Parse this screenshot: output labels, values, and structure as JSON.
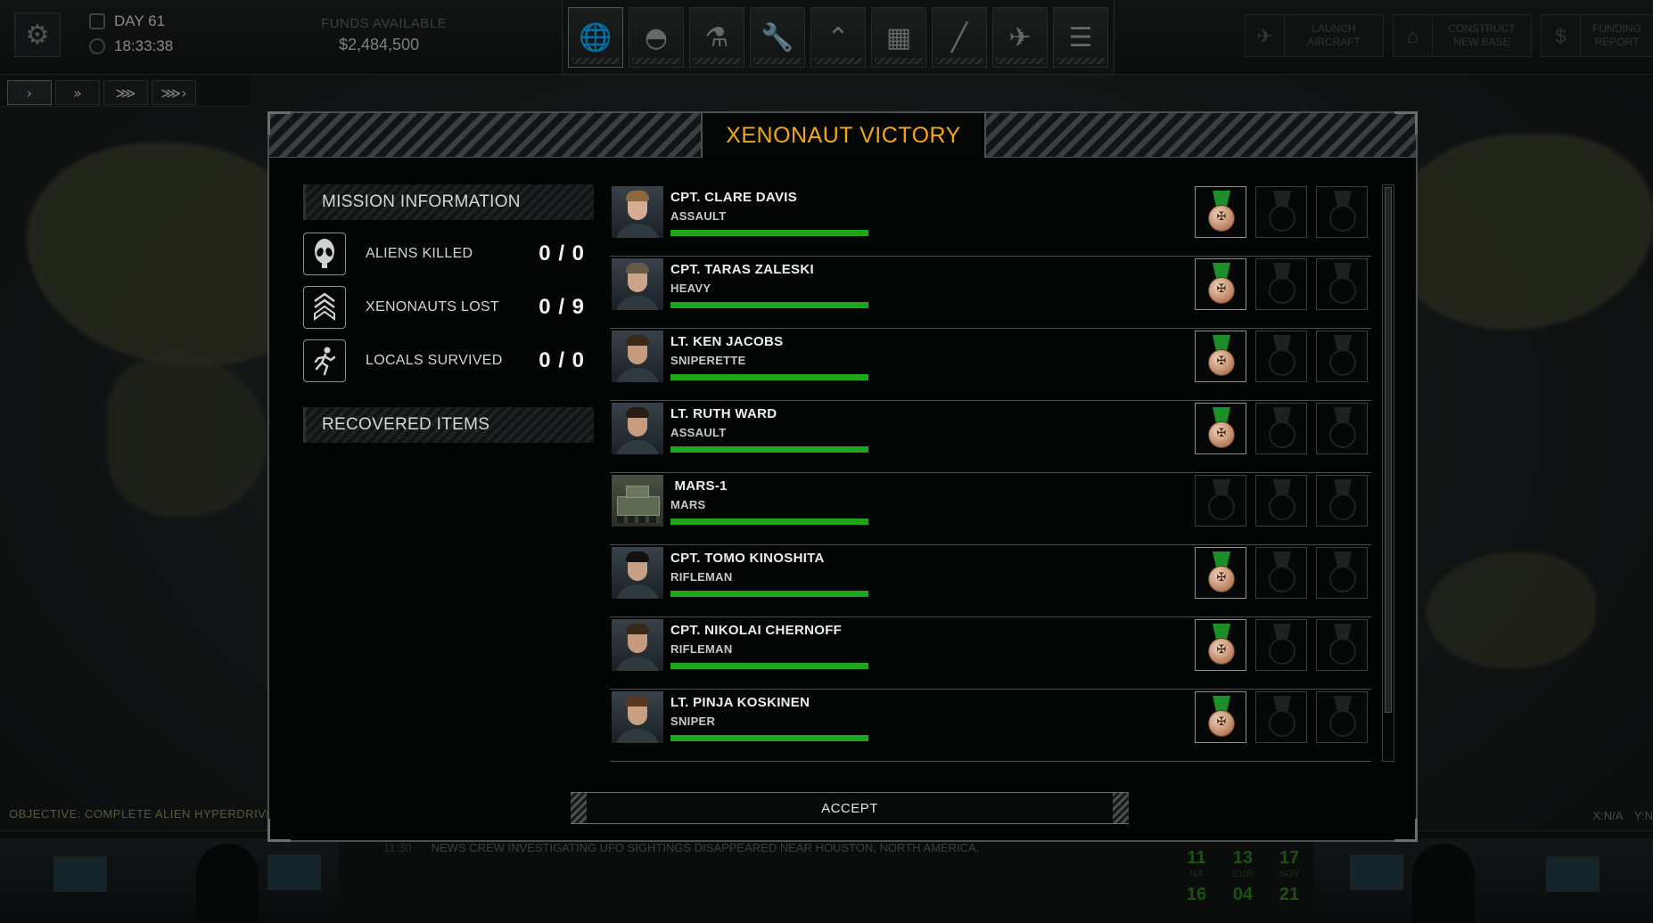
{
  "hud": {
    "day": "DAY 61",
    "time": "18:33:38",
    "funds_label": "FUNDS AVAILABLE",
    "funds_value": "$2,484,500",
    "tabs": [
      {
        "name": "geoscape",
        "icon": "globe-icon",
        "glyph": "🌐",
        "active": true
      },
      {
        "name": "base",
        "icon": "dome-icon",
        "glyph": "◓",
        "active": false
      },
      {
        "name": "research",
        "icon": "microscope-icon",
        "glyph": "⚗",
        "active": false
      },
      {
        "name": "engineering",
        "icon": "wrench-icon",
        "glyph": "🔧",
        "active": false
      },
      {
        "name": "soldiers",
        "icon": "rank-chevron-icon",
        "glyph": "⌃",
        "active": false
      },
      {
        "name": "stores",
        "icon": "crates-icon",
        "glyph": "▦",
        "active": false
      },
      {
        "name": "armory",
        "icon": "rifle-icon",
        "glyph": "╱",
        "active": false
      },
      {
        "name": "hangar",
        "icon": "jet-icon",
        "glyph": "✈",
        "active": false
      },
      {
        "name": "archives",
        "icon": "cabinet-icon",
        "glyph": "☰",
        "active": false
      }
    ],
    "actions": [
      {
        "label_1": "LAUNCH",
        "label_2": "AIRCRAFT"
      },
      {
        "label_1": "CONSTRUCT",
        "label_2": "NEW BASE"
      },
      {
        "label_1": "FUNDING",
        "label_2": "REPORT"
      }
    ],
    "speed": [
      "›",
      "»",
      "⋙",
      "⋙›"
    ]
  },
  "objective": "OBJECTIVE: COMPLETE ALIEN HYPERDRIVE RE",
  "coords": "X:N/A Y:N",
  "ticker": {
    "time": "11:30",
    "text": "NEWS CREW INVESTIGATING UFO SIGHTINGS DISAPPEARED NEAR HOUSTON, NORTH AMERICA."
  },
  "regions": [
    {
      "value": "11",
      "code": "NA"
    },
    {
      "value": "13",
      "code": "EUR"
    },
    {
      "value": "17",
      "code": "SOV"
    },
    {
      "value": "16",
      "code": ""
    },
    {
      "value": "04",
      "code": ""
    },
    {
      "value": "21",
      "code": ""
    }
  ],
  "modal": {
    "title": "XENONAUT VICTORY",
    "mission_heading": "MISSION INFORMATION",
    "stats": [
      {
        "label": "ALIENS KILLED",
        "value": "0 / 0",
        "icon": "alien-head-icon"
      },
      {
        "label": "XENONAUTS LOST",
        "value": "0 / 9",
        "icon": "rank-chevron-icon"
      },
      {
        "label": "LOCALS SURVIVED",
        "value": "0 / 0",
        "icon": "running-person-icon"
      }
    ],
    "recovered_heading": "RECOVERED ITEMS",
    "accept_label": "ACCEPT"
  },
  "roster": [
    {
      "name": "CPT. CLARE DAVIS",
      "class": "ASSAULT",
      "health": 1.0,
      "medals": [
        true,
        false,
        false
      ],
      "portrait": "female"
    },
    {
      "name": "CPT. TARAS ZALESKI",
      "class": "HEAVY",
      "health": 1.0,
      "medals": [
        true,
        false,
        false
      ],
      "portrait": "male-short"
    },
    {
      "name": "LT. KEN JACOBS",
      "class": "SNIPERETTE",
      "health": 1.0,
      "medals": [
        true,
        false,
        false
      ],
      "portrait": "male"
    },
    {
      "name": "LT. RUTH WARD",
      "class": "ASSAULT",
      "health": 1.0,
      "medals": [
        true,
        false,
        false
      ],
      "portrait": "female-dark"
    },
    {
      "name": " MARS-1",
      "class": "MARS",
      "health": 1.0,
      "medals": [
        false,
        false,
        false
      ],
      "portrait": "vehicle"
    },
    {
      "name": "CPT. TOMO KINOSHITA",
      "class": "RIFLEMAN",
      "health": 1.0,
      "medals": [
        true,
        false,
        false
      ],
      "portrait": "male-dark"
    },
    {
      "name": "CPT. NIKOLAI CHERNOFF",
      "class": "RIFLEMAN",
      "health": 1.0,
      "medals": [
        true,
        false,
        false
      ],
      "portrait": "male"
    },
    {
      "name": "LT. PINJA KOSKINEN",
      "class": "SNIPER",
      "health": 1.0,
      "medals": [
        true,
        false,
        false
      ],
      "portrait": "female-brown"
    }
  ],
  "colors": {
    "title": "#f4a817",
    "health_bar": "#1fa51a",
    "ribbon": "#1a8f2a",
    "medal": "#c08a6a"
  }
}
